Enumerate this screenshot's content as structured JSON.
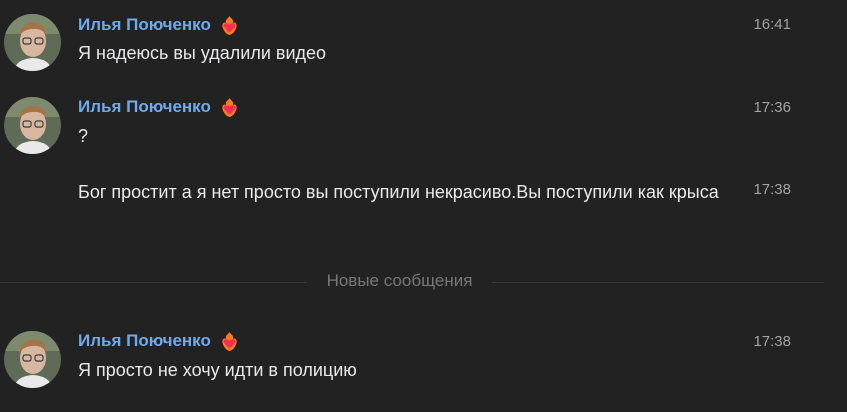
{
  "author": {
    "name": "Илья Поюченко",
    "badge_icon": "heart-fire-icon",
    "name_color": "#71aaeb"
  },
  "messages": [
    {
      "time": "16:41",
      "text": "Я надеюсь вы удалили видео"
    },
    {
      "time": "17:36",
      "text": "?"
    },
    {
      "time": "17:38",
      "text": "Бог простит а я нет просто вы поступили некрасиво.Вы поступили как крыса"
    },
    {
      "time": "17:38",
      "text": "Я просто не хочу идти в полицию"
    }
  ],
  "divider": {
    "label": "Новые сообщения"
  },
  "colors": {
    "background": "#222222",
    "text": "#e9eaec",
    "timestamp": "#a3a3a3",
    "divider_text": "#76787a"
  }
}
